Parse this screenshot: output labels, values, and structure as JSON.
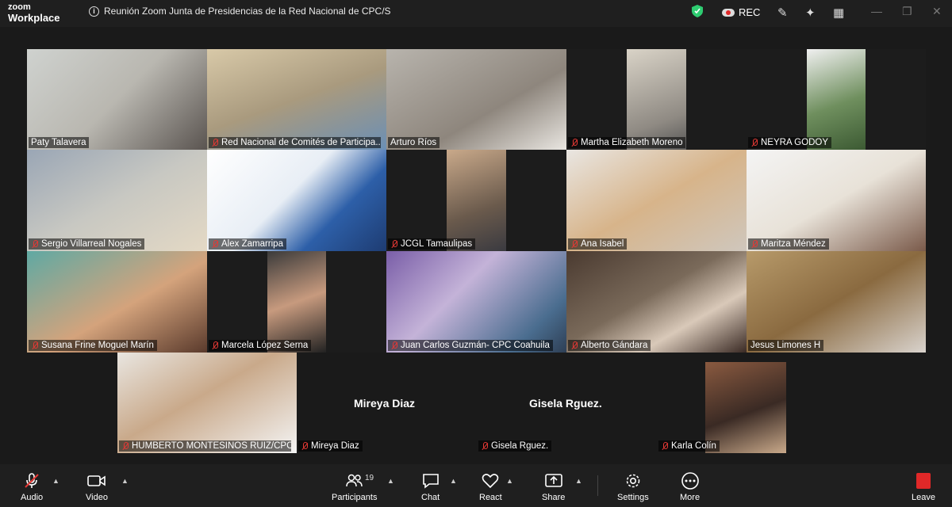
{
  "app": {
    "brand_top": "zoom",
    "brand_bottom": "Workplace"
  },
  "meeting": {
    "title": "Reunión Zoom Junta de Presidencias de la Red Nacional de CPC/S",
    "rec_label": "REC"
  },
  "participants": [
    {
      "name": "Paty Talavera",
      "muted": false
    },
    {
      "name": "Red Nacional de Comités de Participa...",
      "muted": true
    },
    {
      "name": "Arturo Ríos",
      "muted": false,
      "active": true
    },
    {
      "name": "Martha Elizabeth Moreno",
      "muted": true
    },
    {
      "name": "NEYRA GODOY",
      "muted": true
    },
    {
      "name": "Sergio Villarreal Nogales",
      "muted": true
    },
    {
      "name": "Alex Zamarripa",
      "muted": true
    },
    {
      "name": "JCGL Tamaulipas",
      "muted": true
    },
    {
      "name": "Ana Isabel",
      "muted": true
    },
    {
      "name": "Maritza Méndez",
      "muted": true
    },
    {
      "name": "Susana Frine Moguel Marín",
      "muted": true
    },
    {
      "name": "Marcela López Serna",
      "muted": true
    },
    {
      "name": "Juan Carlos Guzmán- CPC Coahuila",
      "muted": true
    },
    {
      "name": "Alberto Gándara",
      "muted": true
    },
    {
      "name": "Jesus Limones H",
      "muted": false
    },
    {
      "name": "HUMBERTO MONTESINOS RUIZ/CPC ...",
      "muted": true
    },
    {
      "name": "Mireya Diaz",
      "muted": true,
      "video_off": true
    },
    {
      "name": "Gisela Rguez.",
      "muted": true,
      "video_off": true
    },
    {
      "name": "Karla Colín",
      "muted": true
    }
  ],
  "toolbar": {
    "audio": "Audio",
    "video": "Video",
    "participants": "Participants",
    "participants_count": "19",
    "chat": "Chat",
    "react": "React",
    "share": "Share",
    "settings": "Settings",
    "more": "More",
    "leave": "Leave"
  },
  "colors": {
    "active_border": "#3ecf5a",
    "muted_icon": "#e53935",
    "leave": "#e02828",
    "shield": "#2ecc71"
  }
}
